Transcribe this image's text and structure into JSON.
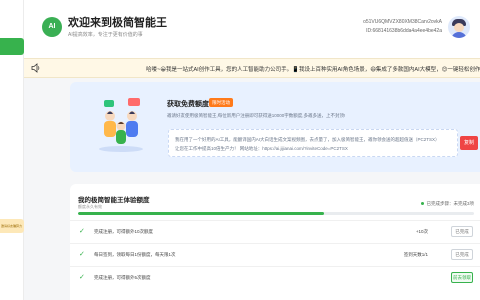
{
  "app": {
    "title": "欢迎来到极简智能王",
    "subtitle": "AI提高效率，专注于更有价值的事",
    "logo": "AI",
    "user_id_line1": "o51VU6QMVZX80XM38Carv2ovkA",
    "user_id_line2": "ID:668141638b6dda4a4ee4be42a"
  },
  "sidebar": {
    "note": "邀请好友赚算力"
  },
  "announcement": {
    "icon": "speaker-icon",
    "text": "哈喽~😀我是一站式AI创作工具，您的人工智能助力公司手。📱我设上百种实用AI角色场景，😄集成了多款国内AI大模型，😊一键轻松创作"
  },
  "promo": {
    "title": "获取免费额度",
    "badge": "限时活动",
    "desc": "邀请好友使用极简智能王,每位新用户注册即可获得送10000字数额度,多邀多送，上不封顶!",
    "invite_line1": "我在用了一个好用的AI工具，能翻译国内AI大白话生成文案视频图，去点量了，加入极简智能王，邀你领会送的超超值送（PC2TSX）",
    "invite_line2": "让您在工作中提高10倍生产力！ 网站地址：https://ai.jijianai.com/?inviteCode=PC2TSX",
    "copy_label": "复制"
  },
  "experience": {
    "title": "我的极简智能王体验额度",
    "subtitle": "额度永久有效",
    "status": "已完成步骤：未完成3项",
    "progress": 0.62,
    "tasks": [
      {
        "label": "完成注册，可得额外10次额度",
        "reward": "+10次",
        "button": "已完成",
        "done": true
      },
      {
        "label": "每日签到，领取每日1份额度，每天限1次",
        "reward": "签到天数1/1",
        "button": "已完成",
        "done": true
      },
      {
        "label": "完成注册，可得额外5次额度",
        "reward": "",
        "button": "前去领取",
        "done": false
      }
    ]
  },
  "colors": {
    "accent": "#37b24d",
    "promo_bg": "#e8f1ff",
    "badge": "#ff7a1a",
    "copy_button": "#ef4444",
    "announcement_bg": "#fff8e6"
  }
}
